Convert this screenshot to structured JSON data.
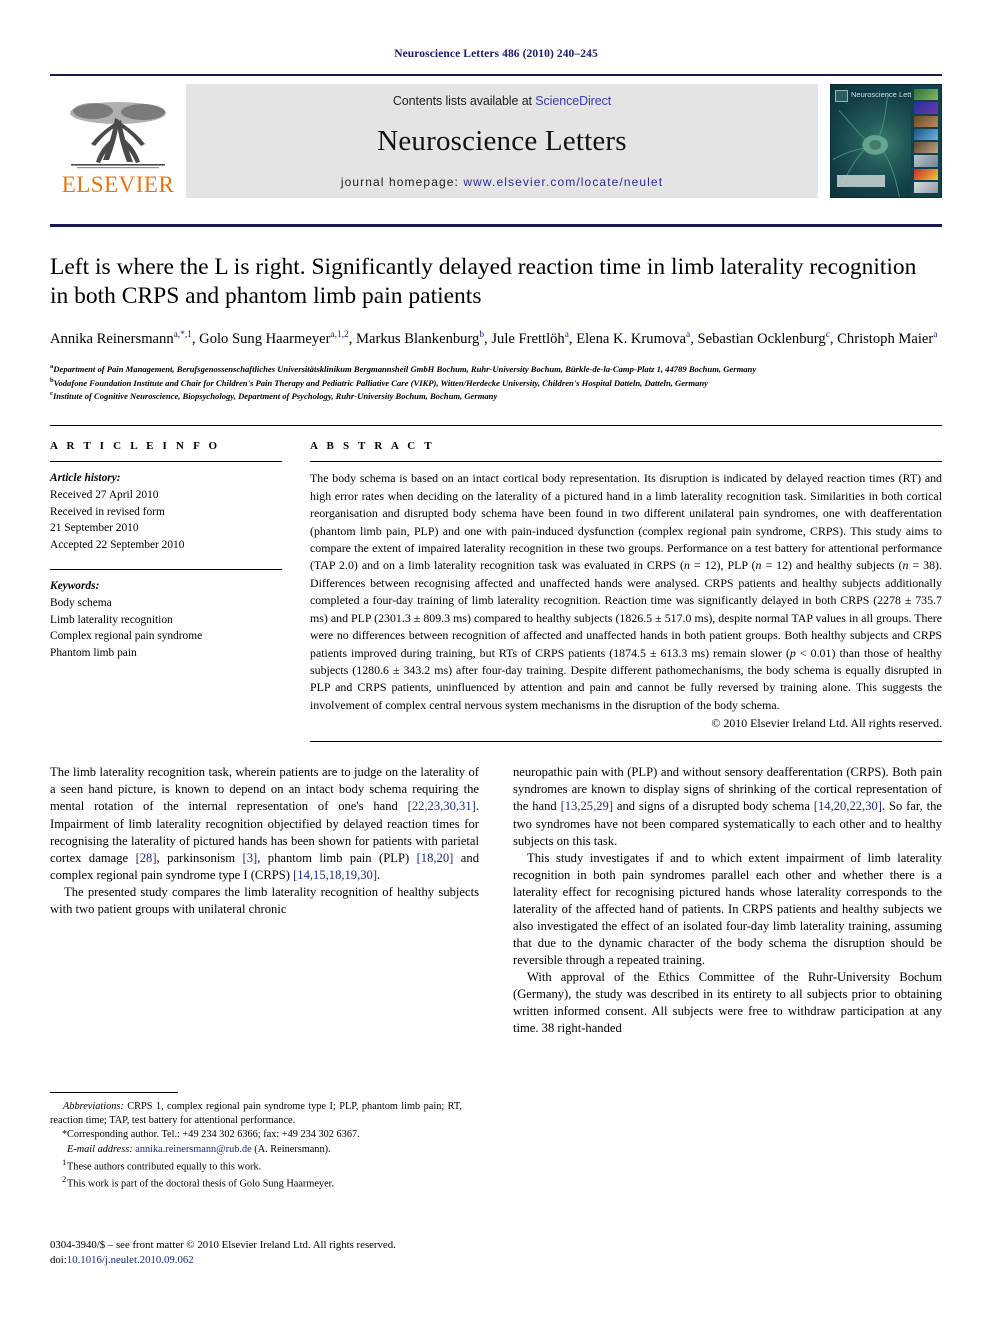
{
  "running_head": "Neuroscience Letters 486 (2010) 240–245",
  "masthead": {
    "contents_prefix": "Contents lists available at ",
    "sciencedirect": "ScienceDirect",
    "journal_name": "Neuroscience Letters",
    "homepage_prefix": "journal homepage: ",
    "homepage_url": "www.elsevier.com/locate/neulet",
    "publisher": "ELSEVIER",
    "cover_title": "Neuroscience Letters",
    "accent_orange": "#E87511",
    "link_blue": "#2b2b9e",
    "rule_navy": "#1a1a4e"
  },
  "article": {
    "title": "Left is where the L is right. Significantly delayed reaction time in limb laterality recognition in both CRPS and phantom limb pain patients",
    "authors": [
      {
        "name": "Annika Reinersmann",
        "sup": "a,*,1",
        "sep": ", "
      },
      {
        "name": "Golo Sung Haarmeyer",
        "sup": "a,1,2",
        "sep": ", "
      },
      {
        "name": "Markus Blankenburg",
        "sup": "b",
        "sep": ", "
      },
      {
        "name": "Jule Frettlöh",
        "sup": "a",
        "sep": ", "
      },
      {
        "name": "Elena K. Krumova",
        "sup": "a",
        "sep": ", "
      },
      {
        "name": "Sebastian Ocklenburg",
        "sup": "c",
        "sep": ", "
      },
      {
        "name": "Christoph Maier",
        "sup": "a",
        "sep": ""
      }
    ],
    "affiliations": [
      {
        "sup": "a",
        "text": "Department of Pain Management, Berufsgenossenschaftliches Universitätsklinikum Bergmannsheil GmbH Bochum, Ruhr-University Bochum, Bürkle-de-la-Camp-Platz 1, 44789 Bochum, Germany"
      },
      {
        "sup": "b",
        "text": "Vodafone Foundation Institute and Chair for Children's Pain Therapy and Pediatric Palliative Care (VIKP), Witten/Herdecke University, Children's Hospital Datteln, Datteln, Germany"
      },
      {
        "sup": "c",
        "text": "Institute of Cognitive Neuroscience, Biopsychology, Department of Psychology, Ruhr-University Bochum, Bochum, Germany"
      }
    ]
  },
  "article_info": {
    "heading": "A R T I C L E   I N F O",
    "history_label": "Article history:",
    "history_lines": [
      "Received 27 April 2010",
      "Received in revised form",
      "21 September 2010",
      "Accepted 22 September 2010"
    ],
    "keywords_label": "Keywords:",
    "keywords": [
      "Body schema",
      "Limb laterality recognition",
      "Complex regional pain syndrome",
      "Phantom limb pain"
    ]
  },
  "abstract": {
    "heading": "A B S T R A C T",
    "text": "The body schema is based on an intact cortical body representation. Its disruption is indicated by delayed reaction times (RT) and high error rates when deciding on the laterality of a pictured hand in a limb laterality recognition task. Similarities in both cortical reorganisation and disrupted body schema have been found in two different unilateral pain syndromes, one with deafferentation (phantom limb pain, PLP) and one with pain-induced dysfunction (complex regional pain syndrome, CRPS). This study aims to compare the extent of impaired laterality recognition in these two groups. Performance on a test battery for attentional performance (TAP 2.0) and on a limb laterality recognition task was evaluated in CRPS (n = 12), PLP (n = 12) and healthy subjects (n = 38). Differences between recognising affected and unaffected hands were analysed. CRPS patients and healthy subjects additionally completed a four-day training of limb laterality recognition. Reaction time was significantly delayed in both CRPS (2278 ± 735.7 ms) and PLP (2301.3 ± 809.3 ms) compared to healthy subjects (1826.5 ± 517.0 ms), despite normal TAP values in all groups. There were no differences between recognition of affected and unaffected hands in both patient groups. Both healthy subjects and CRPS patients improved during training, but RTs of CRPS patients (1874.5 ± 613.3 ms) remain slower (p < 0.01) than those of healthy subjects (1280.6 ± 343.2 ms) after four-day training. Despite different pathomechanisms, the body schema is equally disrupted in PLP and CRPS patients, uninfluenced by attention and pain and cannot be fully reversed by training alone. This suggests the involvement of complex central nervous system mechanisms in the disruption of the body schema.",
    "copyright": "© 2010 Elsevier Ireland Ltd. All rights reserved."
  },
  "body": {
    "left_paragraphs": [
      "The limb laterality recognition task, wherein patients are to judge on the laterality of a seen hand picture, is known to depend on an intact body schema requiring the mental rotation of the internal representation of one's hand [22,23,30,31]. Impairment of limb laterality recognition objectified by delayed reaction times for recognising the laterality of pictured hands has been shown for patients with parietal cortex damage [28], parkinsonism [3], phantom limb pain (PLP) [18,20] and complex regional pain syndrome type I (CRPS) [14,15,18,19,30].",
      "The presented study compares the limb laterality recognition of healthy subjects with two patient groups with unilateral chronic"
    ],
    "right_paragraphs": [
      "neuropathic pain with (PLP) and without sensory deafferentation (CRPS). Both pain syndromes are known to display signs of shrinking of the cortical representation of the hand [13,25,29] and signs of a disrupted body schema [14,20,22,30]. So far, the two syndromes have not been compared systematically to each other and to healthy subjects on this task.",
      "This study investigates if and to which extent impairment of limb laterality recognition in both pain syndromes parallel each other and whether there is a laterality effect for recognising pictured hands whose laterality corresponds to the laterality of the affected hand of patients. In CRPS patients and healthy subjects we also investigated the effect of an isolated four-day limb laterality training, assuming that due to the dynamic character of the body schema the disruption should be reversible through a repeated training.",
      "With approval of the Ethics Committee of the Ruhr-University Bochum (Germany), the study was described in its entirety to all subjects prior to obtaining written informed consent. All subjects were free to withdraw participation at any time. 38 right-handed"
    ]
  },
  "footnotes": {
    "abbreviations_label": "Abbreviations:",
    "abbreviations_text": "CRPS 1, complex regional pain syndrome type I; PLP, phantom limb pain; RT, reaction time; TAP, test battery for attentional performance.",
    "corresponding_marker": "*",
    "corresponding_text": "Corresponding author. Tel.: +49 234 302 6366; fax: +49 234 302 6367.",
    "email_label": "E-mail address:",
    "email": "annika.reinersmann@rub.de",
    "email_suffix": " (A. Reinersmann).",
    "note1_marker": "1",
    "note1_text": "These authors contributed equally to this work.",
    "note2_marker": "2",
    "note2_text": "This work is part of the doctoral thesis of Golo Sung Haarmeyer."
  },
  "imprint": {
    "line1": "0304-3940/$ – see front matter © 2010 Elsevier Ireland Ltd. All rights reserved.",
    "doi_label": "doi:",
    "doi": "10.1016/j.neulet.2010.09.062"
  }
}
